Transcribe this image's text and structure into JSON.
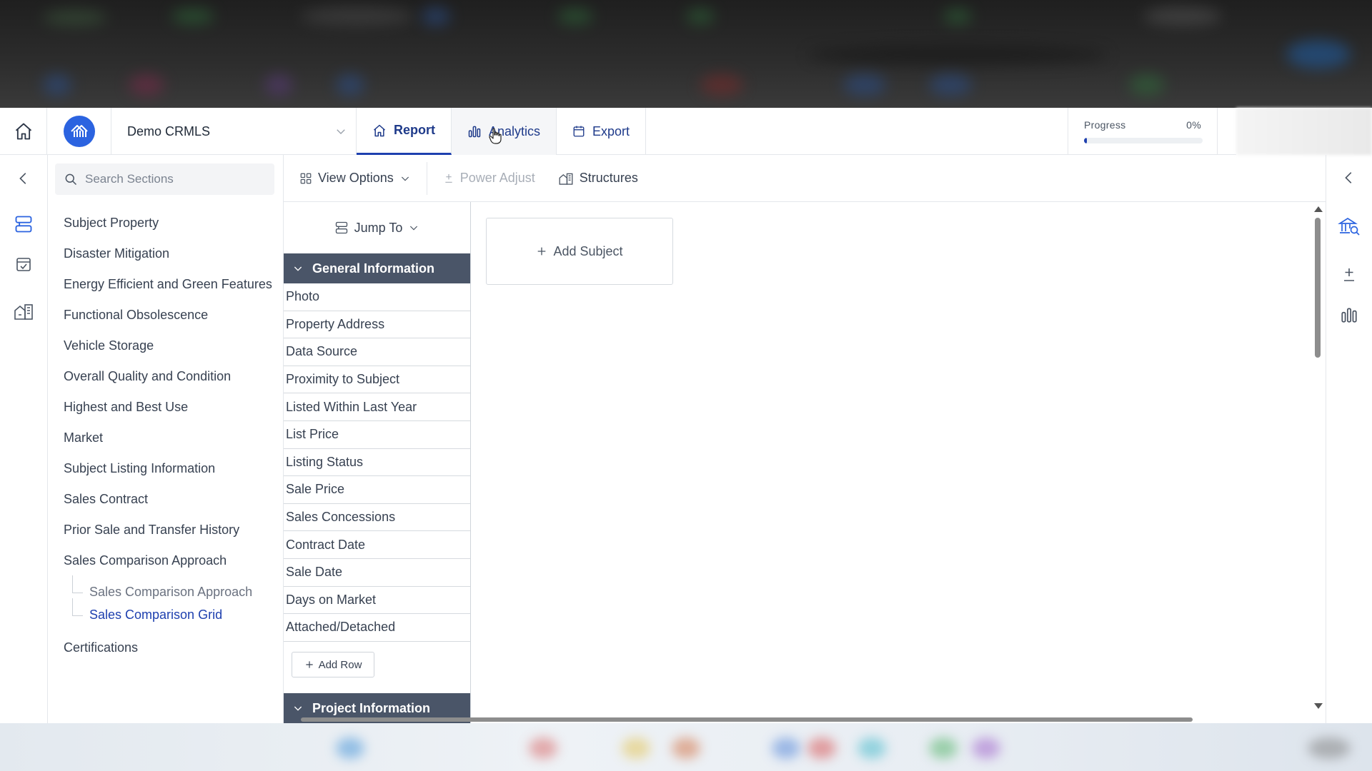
{
  "header": {
    "org_name": "Demo CRMLS",
    "tabs": [
      {
        "label": "Report",
        "icon": "house-icon"
      },
      {
        "label": "Analytics",
        "icon": "bar-chart-icon"
      },
      {
        "label": "Export",
        "icon": "calendar-icon"
      }
    ],
    "progress": {
      "label": "Progress",
      "value_text": "0%",
      "value": 0
    }
  },
  "search": {
    "placeholder": "Search Sections"
  },
  "toolbar": {
    "view_options": "View Options",
    "power_adjust": "Power Adjust",
    "structures": "Structures"
  },
  "nav": {
    "items": [
      "Subject Property",
      "Disaster Mitigation",
      "Energy Efficient and Green Features",
      "Functional Obsolescence",
      "Vehicle Storage",
      "Overall Quality and Condition",
      "Highest and Best Use",
      "Market",
      "Subject Listing Information",
      "Sales Contract",
      "Prior Sale and Transfer History",
      "Sales Comparison Approach"
    ],
    "sub_items": [
      "Sales Comparison Approach",
      "Sales Comparison Grid"
    ],
    "last_item": "Certifications"
  },
  "grid": {
    "jump_to": "Jump To",
    "general_section": "General Information",
    "rows": [
      "Photo",
      "Property Address",
      "Data Source",
      "Proximity to Subject",
      "Listed Within Last Year",
      "List Price",
      "Listing Status",
      "Sale Price",
      "Sales Concessions",
      "Contract Date",
      "Sale Date",
      "Days on Market",
      "Attached/Detached"
    ],
    "add_row": "Add Row",
    "project_section": "Project Information"
  },
  "main": {
    "add_subject": "Add Subject"
  },
  "colors": {
    "accent": "#1e40af",
    "logo": "#2b63e0",
    "section_header": "#4a5568"
  }
}
